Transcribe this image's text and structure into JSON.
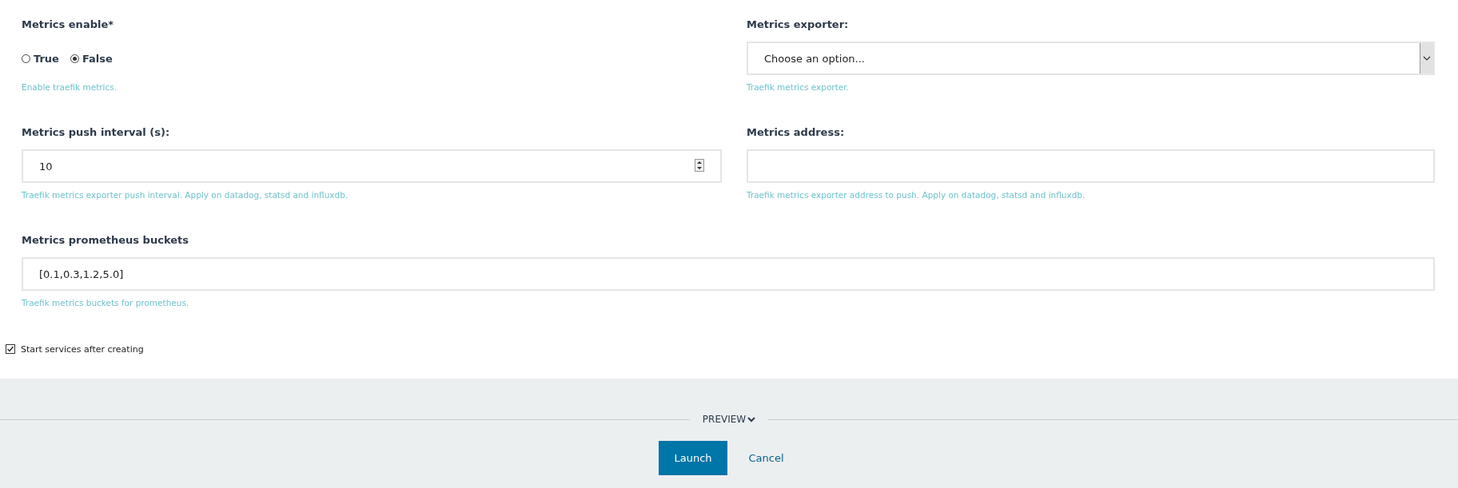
{
  "fields": [
    {
      "kind": "radio",
      "label": "Metrics enable*",
      "options": [
        {
          "label": "True",
          "selected": false
        },
        {
          "label": "False",
          "selected": true
        }
      ],
      "help": "Enable traefik metrics."
    },
    {
      "kind": "select",
      "label": "Metrics exporter:",
      "placeholder": "Choose an option...",
      "help": "Traefik metrics exporter."
    },
    {
      "kind": "number",
      "label": "Metrics push interval (s):",
      "value": "10",
      "help": "Traefik metrics exporter push interval. Apply on datadog, statsd and influxdb."
    },
    {
      "kind": "text",
      "label": "Metrics address:",
      "help": "Traefik metrics exporter address to push. Apply on datadog, statsd and influxdb."
    },
    {
      "kind": "wide",
      "label": "Metrics prometheus buckets",
      "value": "[0.1,0.3,1.2,5.0]",
      "help": "Traefik metrics buckets for prometheus."
    }
  ],
  "start_services": {
    "label": "Start services after creating",
    "checked": true
  },
  "preview": {
    "label": "PREVIEW"
  },
  "buttons": [
    {
      "kind": "primary",
      "label": "Launch"
    },
    {
      "kind": "link",
      "label": "Cancel"
    }
  ]
}
